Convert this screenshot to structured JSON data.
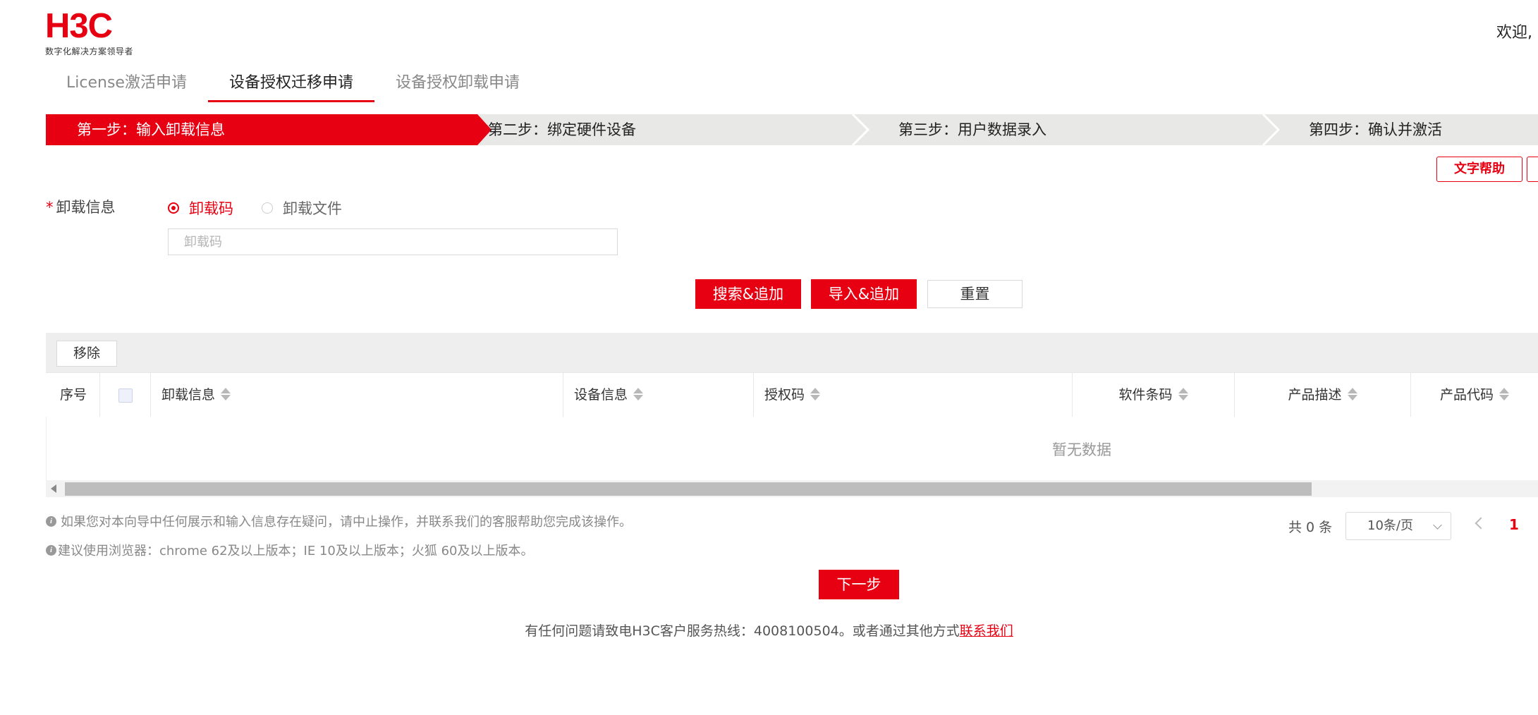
{
  "logo": {
    "text": "H3C",
    "tagline": "数字化解决方案领导者"
  },
  "header": {
    "welcome": "欢迎,"
  },
  "tabs": [
    {
      "label": "License激活申请",
      "active": false
    },
    {
      "label": "设备授权迁移申请",
      "active": true
    },
    {
      "label": "设备授权卸载申请",
      "active": false
    }
  ],
  "steps": [
    {
      "label": "第一步：输入卸载信息",
      "active": true
    },
    {
      "label": "第二步：绑定硬件设备",
      "active": false
    },
    {
      "label": "第三步：用户数据录入",
      "active": false
    },
    {
      "label": "第四步：确认并激活",
      "active": false
    }
  ],
  "help": {
    "text_help": "文字帮助"
  },
  "form": {
    "required_mark": "*",
    "label": "卸载信息",
    "radios": [
      {
        "label": "卸载码",
        "selected": true
      },
      {
        "label": "卸载文件",
        "selected": false
      }
    ],
    "input_placeholder": "卸载码",
    "input_value": ""
  },
  "actions": {
    "search_add": "搜索&追加",
    "import_add": "导入&追加",
    "reset": "重置"
  },
  "table": {
    "remove": "移除",
    "columns": [
      "序号",
      "卸载信息",
      "设备信息",
      "授权码",
      "软件条码",
      "产品描述",
      "产品代码"
    ],
    "rows": [],
    "empty_text": "暂无数据"
  },
  "notes": [
    "如果您对本向导中任何展示和输入信息存在疑问，请中止操作，并联系我们的客服帮助您完成该操作。",
    "建议使用浏览器：chrome 62及以上版本；IE 10及以上版本；火狐 60及以上版本。"
  ],
  "pager": {
    "total": "共 0 条",
    "page_size": "10条/页",
    "current_page": "1"
  },
  "next_button": "下一步",
  "footer": {
    "text": "有任何问题请致电H3C客户服务热线：4008100504。或者通过其他方式",
    "link": "联系我们"
  },
  "colors": {
    "accent": "#e60012",
    "step_bg": "#e8e8e6",
    "toolbar_bg": "#eeeeee"
  }
}
